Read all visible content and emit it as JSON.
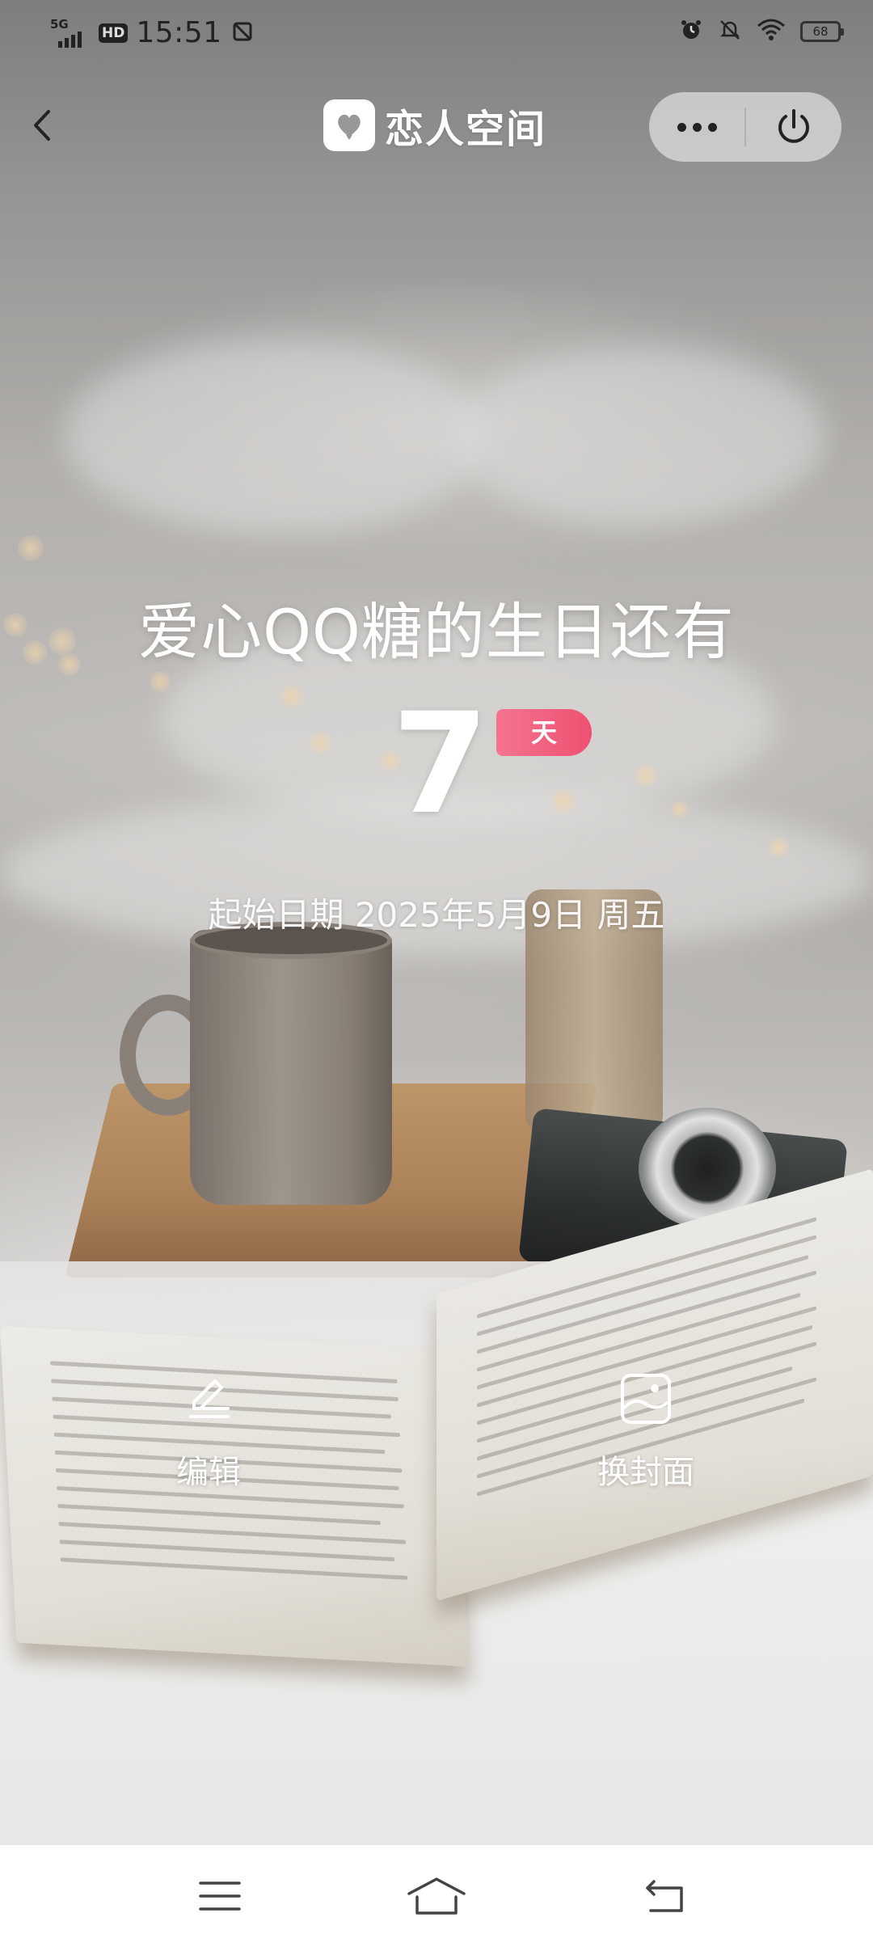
{
  "status_bar": {
    "network": "5G",
    "hd": "HD",
    "time": "15:51",
    "battery": "68",
    "icons": [
      "sim-icon",
      "alarm-icon",
      "mute-icon",
      "wifi-icon",
      "battery-icon"
    ]
  },
  "nav": {
    "title": "恋人空间",
    "back_icon": "chevron-left-icon",
    "logo_icon": "heart-chat-icon",
    "more_icon": "more-dots-icon",
    "close_icon": "power-icon"
  },
  "countdown": {
    "title": "爱心QQ糖的生日还有",
    "days": "7",
    "unit": "天",
    "start_date": "起始日期 2025年5月9日 周五"
  },
  "actions": [
    {
      "label": "编辑",
      "icon": "edit-pen-icon"
    },
    {
      "label": "换封面",
      "icon": "image-icon"
    }
  ],
  "system_nav": {
    "icons": [
      "menu-icon",
      "home-icon",
      "back-icon"
    ]
  },
  "colors": {
    "badge": "#ef5071",
    "text": "#ffffff"
  }
}
